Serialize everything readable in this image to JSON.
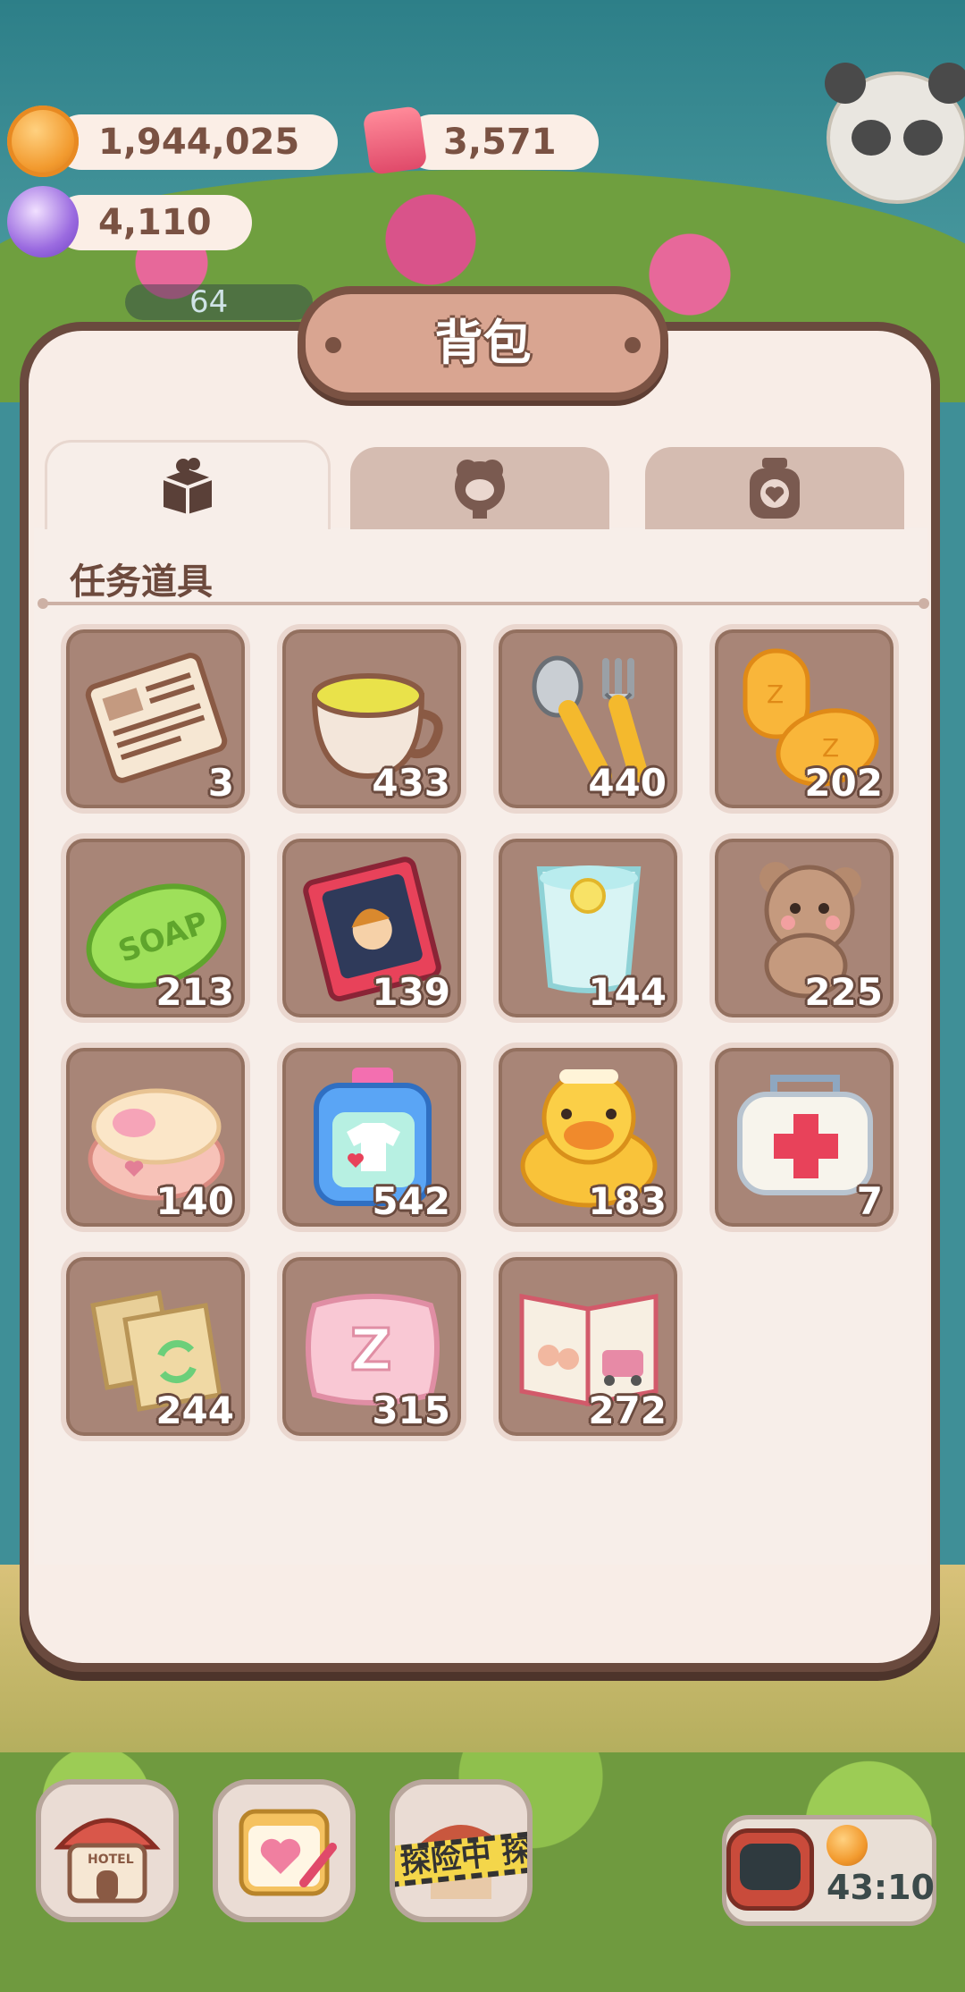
{
  "currencies": {
    "coins": {
      "value": "1,944,025",
      "icon": "cookie-coin-icon"
    },
    "gems": {
      "value": "3,571",
      "icon": "pink-cube-icon"
    },
    "candy": {
      "value": "4,110",
      "icon": "candy-icon"
    }
  },
  "background": {
    "side_counter": "64"
  },
  "panel": {
    "title": "背包",
    "tabs": [
      {
        "icon": "gift-box-icon",
        "active": true
      },
      {
        "icon": "character-head-icon",
        "active": false
      },
      {
        "icon": "jar-heart-icon",
        "active": false
      }
    ],
    "section_title": "任务道具",
    "items": [
      {
        "name": "newspaper",
        "count": "3"
      },
      {
        "name": "tea-cup",
        "count": "433"
      },
      {
        "name": "spoon-fork",
        "count": "440"
      },
      {
        "name": "earplugs",
        "count": "202"
      },
      {
        "name": "soap",
        "count": "213"
      },
      {
        "name": "storybook",
        "count": "139"
      },
      {
        "name": "lemon-water",
        "count": "144"
      },
      {
        "name": "teddy-bear",
        "count": "225"
      },
      {
        "name": "bath-sponge",
        "count": "140"
      },
      {
        "name": "laundry-detergent",
        "count": "542"
      },
      {
        "name": "rubber-duck",
        "count": "183"
      },
      {
        "name": "first-aid-kit",
        "count": "7"
      },
      {
        "name": "recycle-bags",
        "count": "244"
      },
      {
        "name": "sleep-pillow",
        "count": "315"
      },
      {
        "name": "magazine",
        "count": "272"
      }
    ]
  },
  "bottom_bar": {
    "hotel_label": "HOTEL",
    "explore_label": "探险中 探",
    "timer": "43:10"
  },
  "colors": {
    "panel_bg": "#f8ede7",
    "panel_border": "#6a4a3e",
    "slot_bg": "#a88577",
    "title_plate": "#d9a591"
  }
}
